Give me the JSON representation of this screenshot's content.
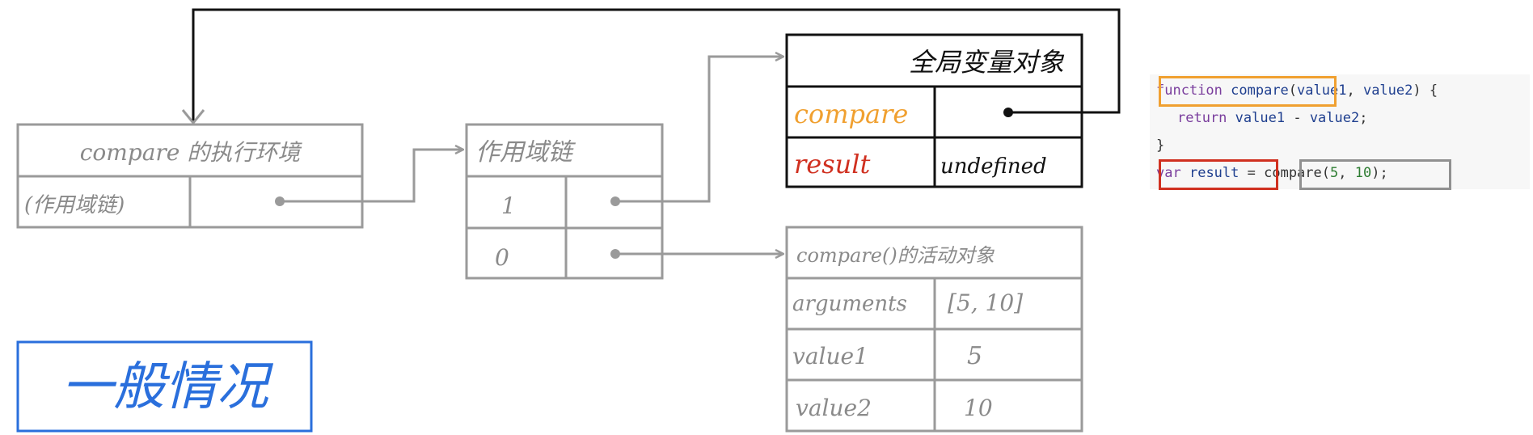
{
  "colors": {
    "line": "#9a9a9a",
    "dark": "#111111",
    "orange": "#f0a030",
    "red": "#d03020",
    "blue": "#2a6fdc",
    "code_gray": "#909090"
  },
  "exec_context": {
    "title": "compare 的执行环境",
    "row_label": "(作用域链)"
  },
  "scope_chain": {
    "title": "作用域链",
    "rows": [
      "1",
      "0"
    ]
  },
  "global_object": {
    "title": "全局变量对象",
    "rows": [
      {
        "name": "compare",
        "value": ""
      },
      {
        "name": "result",
        "value": "undefined"
      }
    ]
  },
  "activation_object": {
    "title": "compare()的活动对象",
    "rows": [
      {
        "name": "arguments",
        "value": "[5, 10]"
      },
      {
        "name": "value1",
        "value": "5"
      },
      {
        "name": "value2",
        "value": "10"
      }
    ]
  },
  "caption": "一般情况",
  "code": {
    "line1_kw": "function",
    "line1_fn": "compare",
    "line1_p1": "value1",
    "line1_p2": "value2",
    "line2_kw": "return",
    "line2_a": "value1",
    "line2_b": "value2",
    "line3": "}",
    "line4_kw": "var",
    "line4_var": "result",
    "line4_fn": "compare",
    "line4_n1": "5",
    "line4_n2": "10"
  }
}
